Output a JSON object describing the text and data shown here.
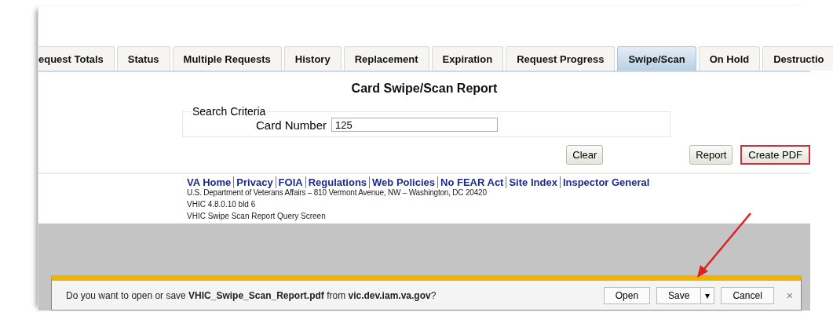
{
  "tabs": [
    {
      "label": "equest Totals",
      "selected": false
    },
    {
      "label": "Status",
      "selected": false
    },
    {
      "label": "Multiple Requests",
      "selected": false
    },
    {
      "label": "History",
      "selected": false
    },
    {
      "label": "Replacement",
      "selected": false
    },
    {
      "label": "Expiration",
      "selected": false
    },
    {
      "label": "Request Progress",
      "selected": false
    },
    {
      "label": "Swipe/Scan",
      "selected": true
    },
    {
      "label": "On Hold",
      "selected": false
    },
    {
      "label": "Destructio",
      "selected": false
    }
  ],
  "page_title": "Card Swipe/Scan Report",
  "search_criteria": {
    "legend": "Search Criteria",
    "card_number": {
      "label": "Card Number",
      "value": "125"
    }
  },
  "buttons": [
    {
      "label": "Clear",
      "highlighted": false
    },
    {
      "label": "Report",
      "highlighted": false
    },
    {
      "label": "Create PDF",
      "highlighted": true
    }
  ],
  "footer": {
    "links": [
      "VA Home",
      "Privacy",
      "FOIA",
      "Regulations",
      "Web Policies",
      "No FEAR Act",
      "Site Index",
      "Inspector General"
    ],
    "address": "U.S. Department of Veterans Affairs – 810 Vermont Avenue, NW – Washington, DC 20420",
    "version": "VHIC 4.8.0.10 bld 6",
    "screen_name": "VHIC Swipe Scan Report Query Screen"
  },
  "download_bar": {
    "message": "Do you want to open or save **VHIC_Swipe_Scan_Report.pdf** from **vic.dev.iam.va.gov**?",
    "buttons": [
      "Open",
      "Save",
      "Cancel"
    ],
    "dropdown": "▾",
    "close": "×"
  }
}
